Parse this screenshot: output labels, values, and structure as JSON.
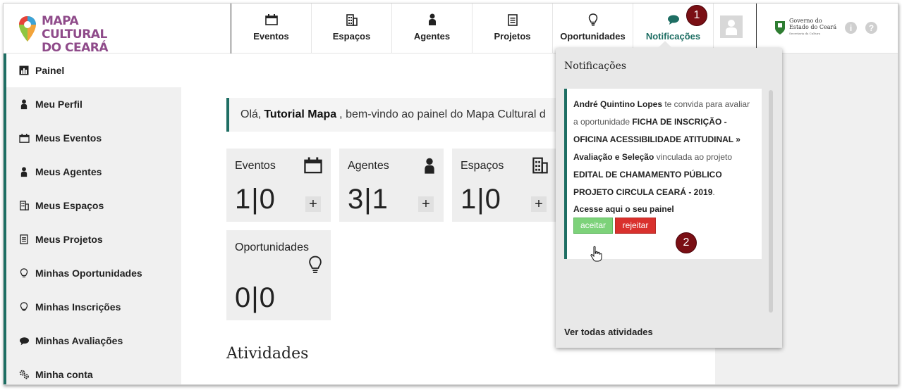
{
  "brand": {
    "line1": "MAPA CULTURAL",
    "line2": "DO CEARÁ"
  },
  "nav": [
    {
      "label": "Eventos",
      "icon": "calendar-icon"
    },
    {
      "label": "Espaços",
      "icon": "building-icon"
    },
    {
      "label": "Agentes",
      "icon": "person-icon"
    },
    {
      "label": "Projetos",
      "icon": "document-icon"
    },
    {
      "label": "Oportunidades",
      "icon": "lightbulb-icon"
    },
    {
      "label": "Notificações",
      "icon": "chat-bubble-icon",
      "active": true
    }
  ],
  "government": {
    "line1": "Governo do",
    "line2": "Estado do Ceará",
    "line3": "Secretaria da Cultura"
  },
  "header_icons": {
    "info": "i",
    "help": "?"
  },
  "badges": {
    "first": "1",
    "second": "2"
  },
  "sidebar": [
    {
      "label": "Painel",
      "icon": "chart-icon"
    },
    {
      "label": "Meu Perfil",
      "icon": "person-icon"
    },
    {
      "label": "Meus Eventos",
      "icon": "calendar-icon"
    },
    {
      "label": "Meus Agentes",
      "icon": "person-icon"
    },
    {
      "label": "Meus Espaços",
      "icon": "building-icon"
    },
    {
      "label": "Meus Projetos",
      "icon": "document-icon"
    },
    {
      "label": "Minhas Oportunidades",
      "icon": "lightbulb-icon"
    },
    {
      "label": "Minhas Inscrições",
      "icon": "lightbulb-icon"
    },
    {
      "label": "Minhas Avaliações",
      "icon": "chat-bubble-icon"
    },
    {
      "label": "Minha conta",
      "icon": "gears-icon"
    }
  ],
  "welcome": {
    "prefix": "Olá,",
    "name": "Tutorial Mapa",
    "suffix": ", bem-vindo ao painel do Mapa Cultural d"
  },
  "cards": [
    {
      "title": "Eventos",
      "value": "1|0",
      "plus": "+"
    },
    {
      "title": "Agentes",
      "value": "3|1",
      "plus": "+"
    },
    {
      "title": "Espaços",
      "value": "1|0",
      "plus": "+"
    },
    {
      "title": "Oportunidades",
      "value": "0|0"
    }
  ],
  "atividades_title": "Atividades",
  "notifications": {
    "title": "Notificações",
    "item": {
      "sender": "André Quintino Lopes",
      "text1": " te convida para avaliar a oportunidade ",
      "opportunity": "FICHA DE INSCRIÇÃO - OFICINA ACESSIBILIDADE ATITUDINAL » Avaliação e Seleção",
      "text2": " vinculada ao projeto ",
      "project": "EDITAL DE CHAMAMENTO PÚBLICO PROJETO CIRCULA CEARÁ - 2019",
      "text3": ".",
      "access": "Acesse aqui o seu painel",
      "accept": "aceitar",
      "reject": "rejeitar"
    },
    "view_all": "Ver todas atividades"
  },
  "colors": {
    "accent": "#1e6e63",
    "brand": "#8f4b8a",
    "accept": "#7dd27a",
    "reject": "#d9312d",
    "badge": "#7a0f14"
  }
}
